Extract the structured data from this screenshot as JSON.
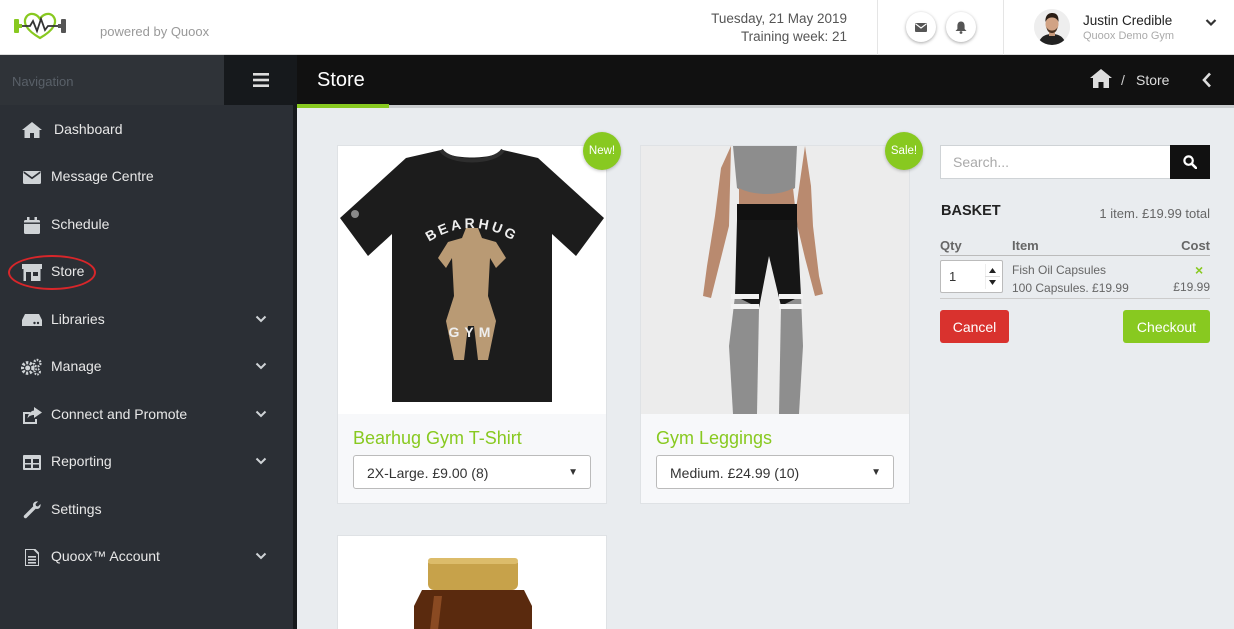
{
  "header": {
    "powered_by": "powered by Quoox",
    "date": "Tuesday, 21 May 2019",
    "training_week": "Training week: 21",
    "user_name": "Justin Credible",
    "user_gym": "Quoox Demo Gym"
  },
  "sidebar": {
    "title": "Navigation",
    "items": [
      {
        "label": "Dashboard",
        "icon": "home-icon"
      },
      {
        "label": "Message Centre",
        "icon": "envelope-icon"
      },
      {
        "label": "Schedule",
        "icon": "calendar-icon"
      },
      {
        "label": "Store",
        "icon": "store-icon"
      },
      {
        "label": "Libraries",
        "icon": "drive-icon"
      },
      {
        "label": "Manage",
        "icon": "gears-icon"
      },
      {
        "label": "Connect and Promote",
        "icon": "share-icon"
      },
      {
        "label": "Reporting",
        "icon": "table-icon"
      },
      {
        "label": "Settings",
        "icon": "wrench-icon"
      },
      {
        "label": "Quoox™ Account",
        "icon": "document-icon"
      }
    ]
  },
  "page": {
    "title": "Store",
    "breadcrumb_current": "Store",
    "breadcrumb_sep": "/"
  },
  "products": [
    {
      "name": "Bearhug Gym T-Shirt",
      "option": "2X-Large. £9.00 (8)",
      "badge": "New!",
      "print_top": "BEARHUG",
      "print_bottom": "GYM"
    },
    {
      "name": "Gym Leggings",
      "option": "Medium. £24.99 (10)",
      "badge": "Sale!"
    },
    {
      "name": "",
      "option": "",
      "badge": ""
    }
  ],
  "search": {
    "placeholder": "Search..."
  },
  "basket": {
    "title": "BASKET",
    "summary": "1 item. £19.99 total",
    "col_qty": "Qty",
    "col_item": "Item",
    "col_cost": "Cost",
    "item": {
      "qty": "1",
      "name": "Fish Oil Capsules",
      "details": "100 Capsules. £19.99",
      "cost": "£19.99",
      "remove": "×"
    },
    "cancel_label": "Cancel",
    "checkout_label": "Checkout"
  },
  "colors": {
    "accent": "#88c920",
    "danger": "#d9322e",
    "sidebar": "#2b2f35"
  }
}
